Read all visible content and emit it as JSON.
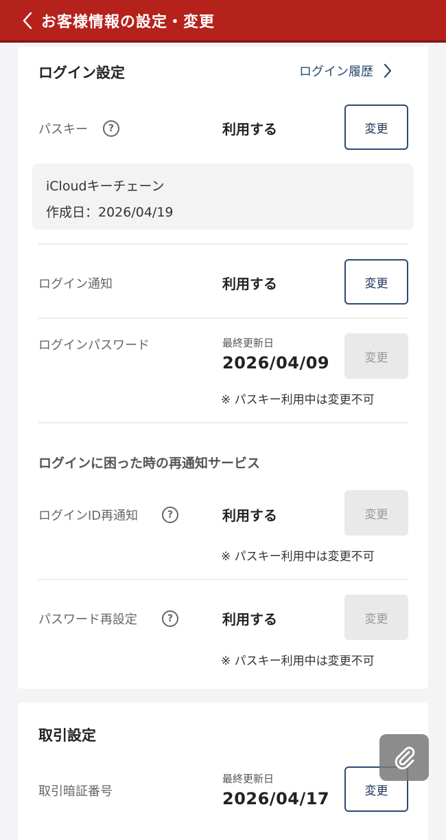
{
  "header": {
    "title": "お客様情報の設定・変更"
  },
  "login_settings": {
    "title": "ログイン設定",
    "history_link": "ログイン履歴",
    "passkey": {
      "label": "パスキー",
      "value": "利用する",
      "button": "変更",
      "info_name": "iCloudキーチェーン",
      "info_date": "作成日：2026/04/19"
    },
    "login_notice": {
      "label": "ログイン通知",
      "value": "利用する",
      "button": "変更"
    },
    "login_password": {
      "label": "ログインパスワード",
      "updated_label": "最終更新日",
      "updated_date": "2026/04/09",
      "button": "変更",
      "note": "※ パスキー利用中は変更不可"
    }
  },
  "recovery": {
    "title": "ログインに困った時の再通知サービス",
    "login_id": {
      "label": "ログインID再通知",
      "value": "利用する",
      "button": "変更",
      "note": "※ パスキー利用中は変更不可"
    },
    "password_reset": {
      "label": "パスワード再設定",
      "value": "利用する",
      "button": "変更",
      "note": "※ パスキー利用中は変更不可"
    }
  },
  "trade_settings": {
    "title": "取引設定",
    "pin": {
      "label": "取引暗証番号",
      "updated_label": "最終更新日",
      "updated_date": "2026/04/17",
      "button": "変更"
    }
  },
  "icons": {
    "back": "chevron-left-icon",
    "link": "chevron-right-icon",
    "help": "question-circle-icon",
    "fab": "paperclip-icon"
  },
  "colors": {
    "header_bg": "#b5211b",
    "button_border": "#2b4a73",
    "disabled_bg": "#e9e9e9"
  },
  "help_glyph": "?"
}
